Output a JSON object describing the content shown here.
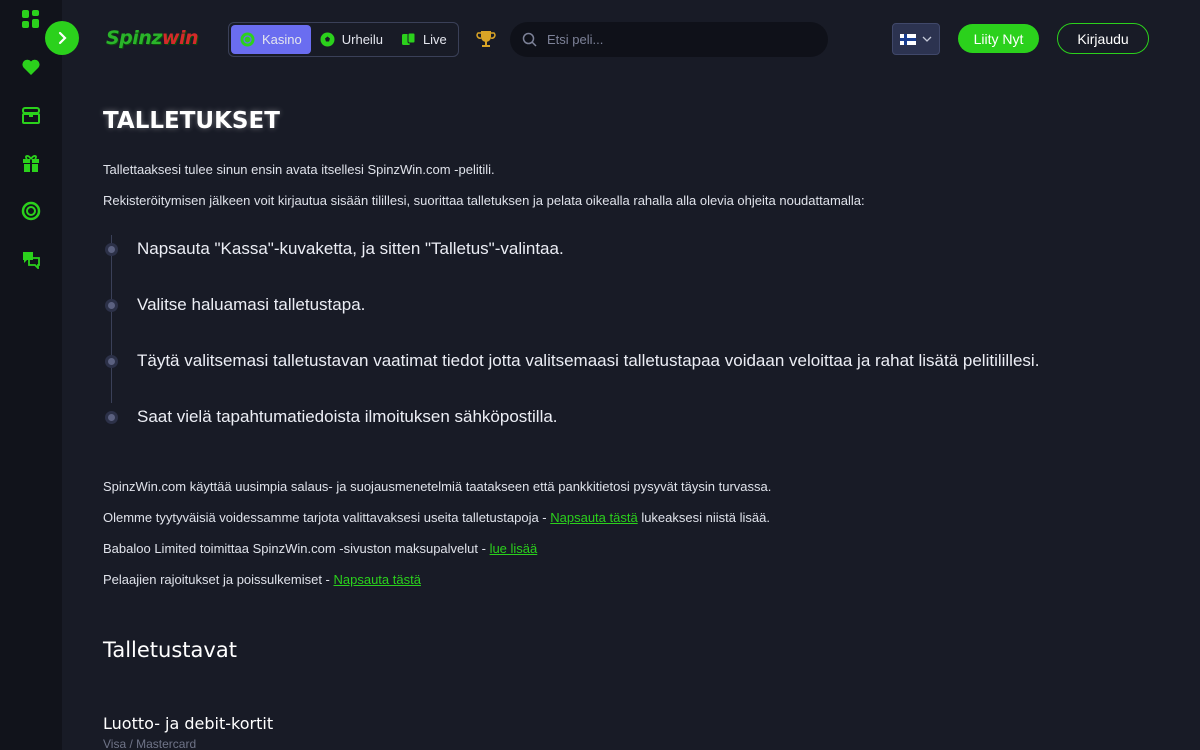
{
  "brand": {
    "logo_main": "Spinz",
    "logo_accent": "win"
  },
  "header": {
    "categories": [
      {
        "label": "Kasino",
        "icon": "casino-chip-icon",
        "active": true
      },
      {
        "label": "Urheilu",
        "icon": "soccer-ball-icon",
        "active": false
      },
      {
        "label": "Live",
        "icon": "live-cards-icon",
        "active": false
      }
    ],
    "search_placeholder": "Etsi peli...",
    "language": "fi",
    "join_label": "Liity Nyt",
    "login_label": "Kirjaudu"
  },
  "sidebar": {
    "icons": [
      "grid-icon",
      "heart-icon",
      "treasure-chest-icon",
      "gift-icon",
      "lifebuoy-icon",
      "chat-support-icon"
    ]
  },
  "main": {
    "title": "TALLETUKSET",
    "intro1": "Tallettaaksesi tulee sinun ensin avata itsellesi SpinzWin.com -pelitili.",
    "intro2": "Rekisteröitymisen jälkeen voit kirjautua sisään tilillesi, suorittaa talletuksen ja pelata oikealla rahalla alla olevia ohjeita noudattamalla:",
    "steps": [
      "Napsauta \"Kassa\"-kuvaketta, ja sitten \"Talletus\"-valintaa.",
      "Valitse haluamasi talletustapa.",
      "Täytä valitsemasi talletustavan vaatimat tiedot jotta valitsemaasi talletustapaa voidaan veloittaa ja rahat lisätä pelitilillesi.",
      "Saat vielä tapahtumatiedoista ilmoituksen sähköpostilla."
    ],
    "security": "SpinzWin.com käyttää uusimpia salaus- ja suojausmenetelmiä taatakseen että pankkitietosi pysyvät täysin turvassa.",
    "methods_before": "Olemme tyytyväisiä voidessamme tarjota valittavaksesi useita talletustapoja - ",
    "methods_link": "Napsauta tästä",
    "methods_after": " lukeaksesi niistä lisää.",
    "babaloo_before": "Babaloo Limited toimittaa SpinzWin.com -sivuston maksupalvelut - ",
    "babaloo_link": "lue lisää",
    "limits_before": "Pelaajien rajoitukset ja poissulkemiset - ",
    "limits_link": "Napsauta tästä",
    "section_title": "Talletustavat",
    "subsection_title": "Luotto- ja debit-kortit",
    "faded_text": "Visa / Mastercard"
  },
  "colors": {
    "accent": "#2bd11c",
    "active_tab": "#6a6df0",
    "background": "#181b26",
    "sidebar": "#11131b"
  }
}
